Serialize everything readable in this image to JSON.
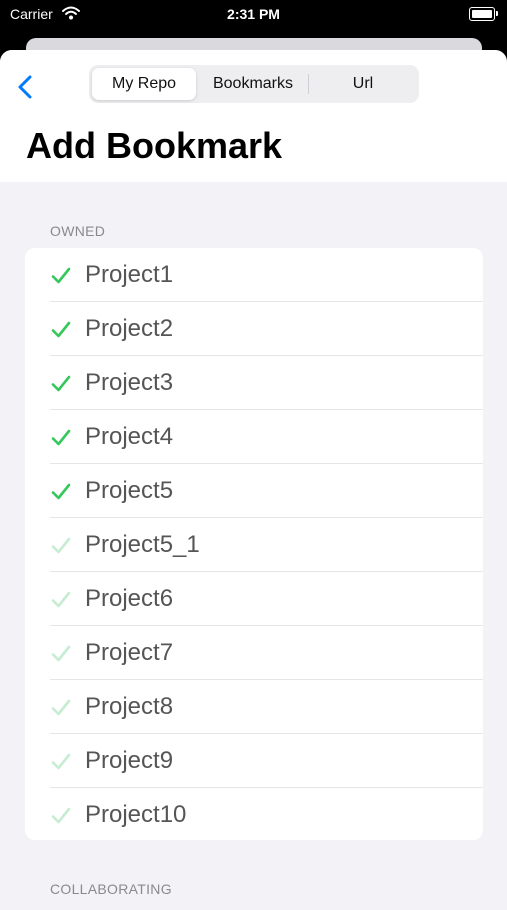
{
  "status_bar": {
    "carrier": "Carrier",
    "time": "2:31 PM"
  },
  "nav": {
    "back_icon": "chevron-left-icon",
    "segments": [
      "My Repo",
      "Bookmarks",
      "Url"
    ],
    "selected_segment": "My Repo"
  },
  "title": "Add Bookmark",
  "sections": {
    "owned": {
      "header": "OWNED",
      "items": [
        {
          "label": "Project1",
          "checked": true
        },
        {
          "label": "Project2",
          "checked": true
        },
        {
          "label": "Project3",
          "checked": true
        },
        {
          "label": "Project4",
          "checked": true
        },
        {
          "label": "Project5",
          "checked": true
        },
        {
          "label": "Project5_1",
          "checked": false
        },
        {
          "label": "Project6",
          "checked": false
        },
        {
          "label": "Project7",
          "checked": false
        },
        {
          "label": "Project8",
          "checked": false
        },
        {
          "label": "Project9",
          "checked": false
        },
        {
          "label": "Project10",
          "checked": false
        }
      ]
    },
    "collaborating": {
      "header": "COLLABORATING"
    }
  },
  "colors": {
    "accent": "#007aff",
    "check_on": "#34c759",
    "check_off": "#c6ecd2"
  }
}
